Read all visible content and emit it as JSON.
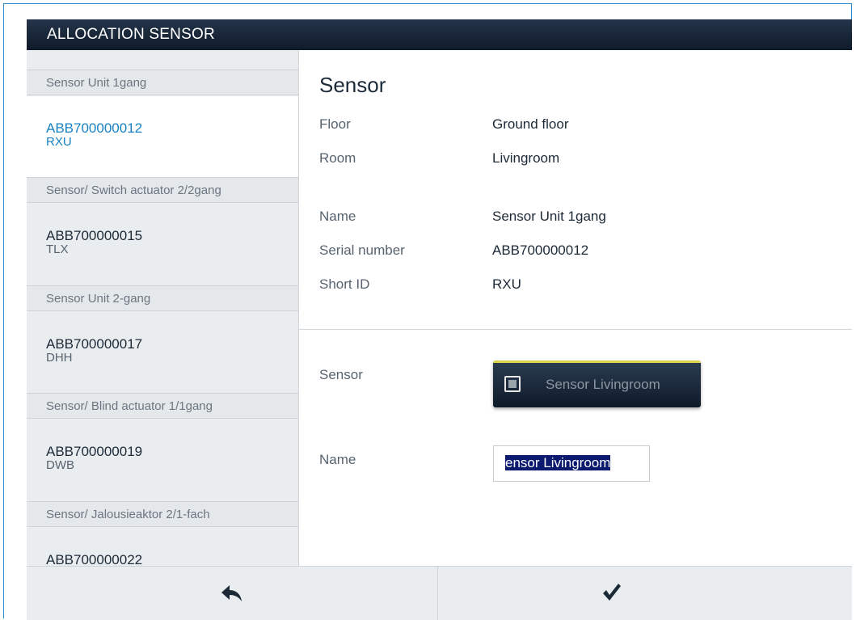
{
  "title": "ALLOCATION SENSOR",
  "sidebar": {
    "groups": [
      {
        "header": "Sensor Unit 1gang",
        "serial": "ABB700000012",
        "short_id": "RXU",
        "selected": true
      },
      {
        "header": "Sensor/ Switch actuator 2/2gang",
        "serial": "ABB700000015",
        "short_id": "TLX",
        "selected": false
      },
      {
        "header": "Sensor Unit 2-gang",
        "serial": "ABB700000017",
        "short_id": "DHH",
        "selected": false
      },
      {
        "header": "Sensor/ Blind actuator 1/1gang",
        "serial": "ABB700000019",
        "short_id": "DWB",
        "selected": false
      },
      {
        "header": "Sensor/ Jalousieaktor 2/1-fach",
        "serial": "ABB700000022",
        "short_id": "",
        "selected": false
      }
    ]
  },
  "detail": {
    "section_title": "Sensor",
    "floor_label": "Floor",
    "floor_value": "Ground floor",
    "room_label": "Room",
    "room_value": "Livingroom",
    "name_label": "Name",
    "name_value": "Sensor Unit 1gang",
    "serial_label": "Serial number",
    "serial_value": "ABB700000012",
    "shortid_label": "Short ID",
    "shortid_value": "RXU",
    "sensor_label": "Sensor",
    "sensor_button": "Sensor Livingroom",
    "edit_name_label": "Name",
    "edit_name_value": "ensor Livingroom"
  },
  "footer": {
    "back_icon": "back-arrow-icon",
    "confirm_icon": "checkmark-icon"
  },
  "colors": {
    "titlebar": "#1a2838",
    "selected_text": "#1a82c4",
    "sensor_button_accent": "#d9d44a",
    "text_selection": "#0b1a6e"
  }
}
